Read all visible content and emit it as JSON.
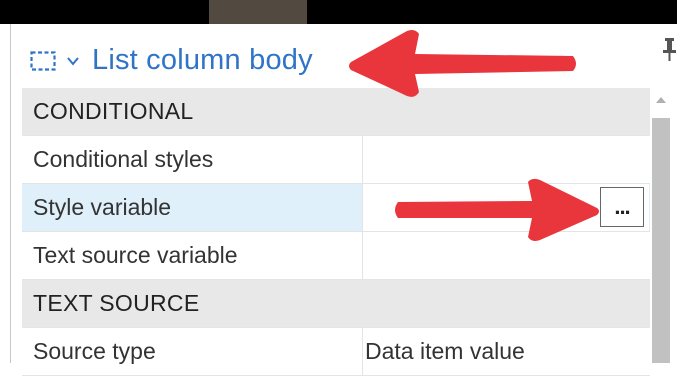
{
  "header": {
    "title": "List column body",
    "icon": "dashed-selection-icon"
  },
  "sections": [
    {
      "label": "CONDITIONAL",
      "rows": [
        {
          "name": "Conditional styles",
          "value": ""
        },
        {
          "name": "Style variable",
          "value": "",
          "selected": true
        },
        {
          "name": "Text source variable",
          "value": ""
        }
      ]
    },
    {
      "label": "TEXT SOURCE",
      "rows": [
        {
          "name": "Source type",
          "value": "Data item value"
        }
      ]
    }
  ],
  "ellipsis_label": "...",
  "colors": {
    "accent": "#2f74c6",
    "arrow": "#e8363c",
    "selected_row": "#dff0fa",
    "section_bg": "#e8e8e8"
  }
}
